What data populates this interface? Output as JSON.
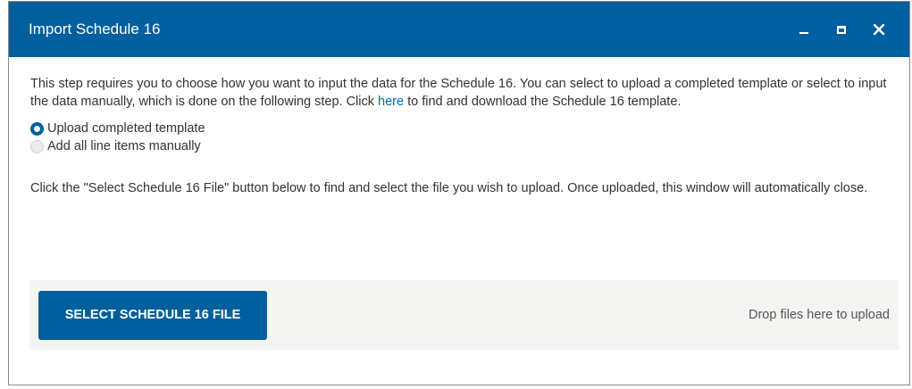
{
  "dialog": {
    "title": "Import Schedule 16",
    "controls": {
      "minimize_icon": "minimize-icon",
      "maximize_icon": "maximize-icon",
      "close_icon": "close-icon"
    },
    "accent_color": "#005f9e"
  },
  "intro": {
    "text_before_link": "This step requires you to choose how you want to input the data for the Schedule 16. You can select to upload a completed template or select to input the data manually, which is done on the following step. Click ",
    "link_text": "here",
    "text_after_link": " to find and download the Schedule 16 template."
  },
  "options": [
    {
      "label": "Upload completed template",
      "selected": true
    },
    {
      "label": "Add all line items manually",
      "selected": false
    }
  ],
  "instruction": "Click the \"Select Schedule 16 File\" button below to find and select the file you wish to upload. Once uploaded, this window will automatically close.",
  "upload": {
    "button_label": "SELECT SCHEDULE 16 FILE",
    "drop_text": "Drop files here to upload"
  }
}
